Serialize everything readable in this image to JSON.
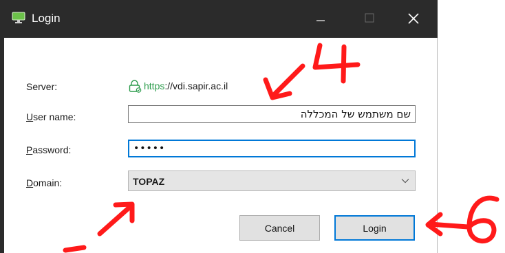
{
  "window": {
    "title": "Login"
  },
  "form": {
    "server_label": "Server:",
    "server_url_prefix": "https",
    "server_url_rest": "://vdi.sapir.ac.il",
    "user_label_u": "U",
    "user_label_rest": "ser name:",
    "user_value": "שם משתמש של המכללה",
    "password_label_u": "P",
    "password_label_rest": "assword:",
    "password_mask": "•••••",
    "domain_label_u": "D",
    "domain_label_rest": "omain:",
    "domain_value": "TOPAZ"
  },
  "buttons": {
    "cancel": "Cancel",
    "login": "Login"
  },
  "annotations": {
    "step4": "4",
    "step6": "6",
    "color": "#ff1a1a"
  },
  "colors": {
    "titlebar": "#2b2b2b",
    "accent": "#0078d7",
    "secure": "#2c9c4c"
  },
  "icons": {
    "app": "monitor-app-icon",
    "lock": "lock-icon",
    "chevron": "chevron-down-icon",
    "minimize": "minimize-icon",
    "maximize": "maximize-icon",
    "close": "close-icon"
  }
}
